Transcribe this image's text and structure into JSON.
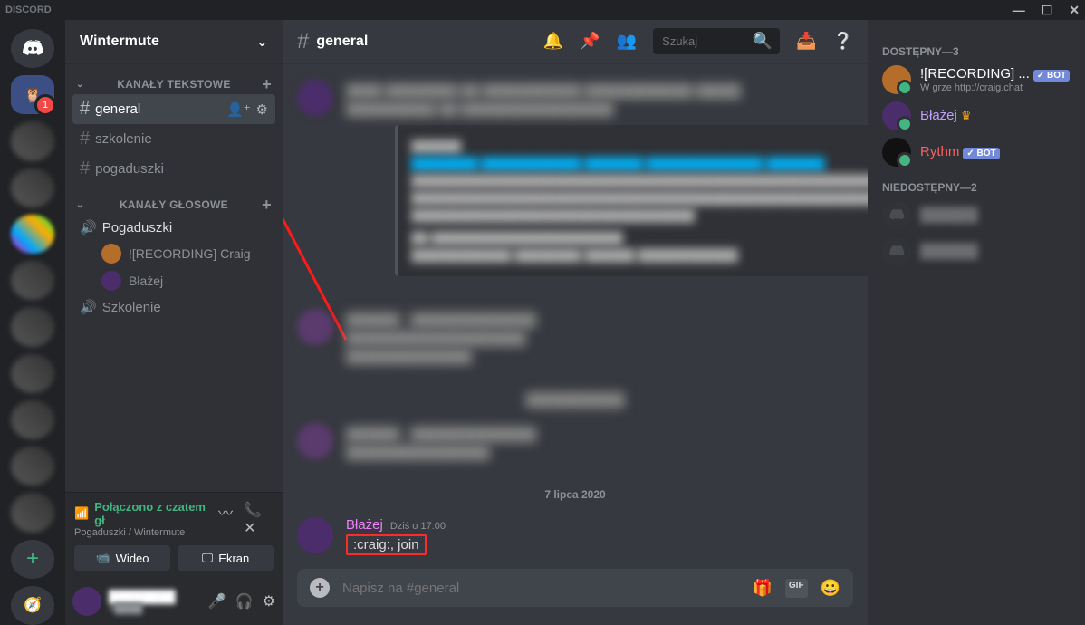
{
  "app_name": "DISCORD",
  "window": {
    "minimize": "—",
    "maximize": "☐",
    "close": "✕"
  },
  "server_name": "Wintermute",
  "rail": {
    "badge": "1"
  },
  "categories": {
    "text": {
      "label": "KANAŁY TEKSTOWE"
    },
    "voice": {
      "label": "KANAŁY GŁOSOWE"
    }
  },
  "text_channels": [
    {
      "name": "general",
      "active": true
    },
    {
      "name": "szkolenie"
    },
    {
      "name": "pogaduszki"
    }
  ],
  "voice_channels": [
    {
      "name": "Pogaduszki",
      "users": [
        {
          "name": "![RECORDING] Craig",
          "avatar": "owl"
        },
        {
          "name": "Błażej",
          "avatar": "wiz"
        }
      ]
    },
    {
      "name": "Szkolenie",
      "users": []
    }
  ],
  "voice_panel": {
    "status": "Połączono z czatem gł",
    "sub": "Pogaduszki / Wintermute",
    "video_btn": "Wideo",
    "screen_btn": "Ekran"
  },
  "channel_header": {
    "name": "general"
  },
  "search": {
    "placeholder": "Szukaj"
  },
  "divider_date": "7 lipca 2020",
  "last_message": {
    "author": "Błażej",
    "timestamp": "Dziś o 17:00",
    "content": ":craig:, join"
  },
  "chatbox": {
    "placeholder": "Napisz na #general"
  },
  "members": {
    "online": {
      "label": "DOSTĘPNY—3",
      "list": [
        {
          "name": "![RECORDING] ...",
          "status": "W grze http://craig.chat",
          "bot": true,
          "color": "#ffffff",
          "avatar": "#b56e2a"
        },
        {
          "name": "Błażej",
          "owner": true,
          "color": "#bfa0ff",
          "avatar": "#4b2d6b"
        },
        {
          "name": "Rythm",
          "bot": true,
          "color": "#ff6060",
          "avatar": "#111"
        }
      ]
    },
    "offline": {
      "label": "NIEDOSTĘPNY—2",
      "list": [
        {
          "name": "",
          "avatar": "#36393f"
        },
        {
          "name": "",
          "avatar": "#36393f"
        }
      ]
    }
  },
  "bot_tag": "✓ BOT",
  "gif_label": "GIF"
}
